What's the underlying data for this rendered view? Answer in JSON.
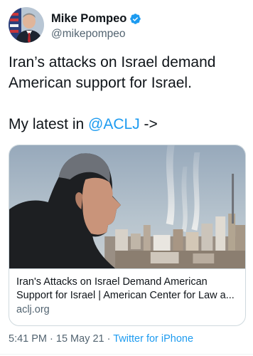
{
  "author": {
    "display_name": "Mike Pompeo",
    "handle": "@mikepompeo",
    "verified": true,
    "verified_icon": "verified-badge-icon"
  },
  "tweet": {
    "line1": "Iran’s attacks on Israel demand",
    "line2": "American support for Israel.",
    "line3_prefix": "My latest in ",
    "mention": "@ACLJ",
    "line3_suffix": " ->"
  },
  "card": {
    "title_line1": "Iran's Attacks on Israel Demand American",
    "title_line2": "Support for Israel | American Center for Law a...",
    "domain": "aclj.org"
  },
  "footer": {
    "time": "5:41 PM",
    "separator": " · ",
    "date": "15 May 21",
    "source": "Twitter for iPhone"
  },
  "colors": {
    "link": "#1d9bf0",
    "secondary_text": "#536471",
    "primary_text": "#0f1419",
    "border": "#cfd9de"
  }
}
